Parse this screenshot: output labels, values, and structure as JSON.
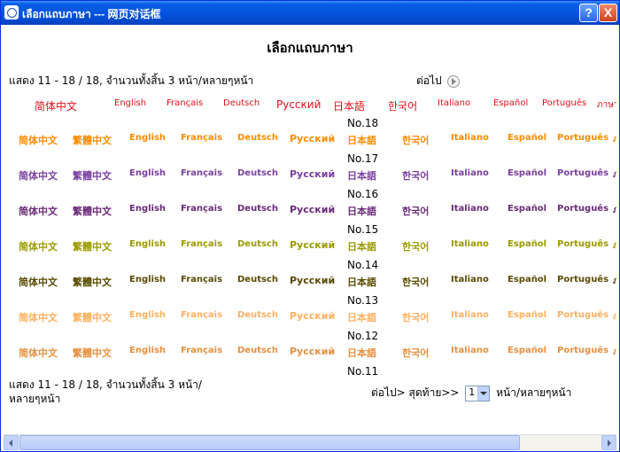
{
  "window": {
    "title": "เลือกแถบภาษา --- 网页对话框",
    "help": "?",
    "close": "X"
  },
  "page_title": "เลือกแถบภาษา",
  "pager_top": {
    "summary": "แสดง 11 - 18 / 18, จำนวนทั้งสิ้น 3 หน้า/หลายๆหน้า",
    "next": "ต่อไป"
  },
  "header_langs": [
    "简体中文",
    "English",
    "Français",
    "Deutsch",
    "Русский",
    "日本語",
    "한국어",
    "Italiano",
    "Español",
    "Português",
    "ภาษาไทย"
  ],
  "row_labels": [
    "简体中文",
    "繁體中文",
    "English",
    "Français",
    "Deutsch",
    "Русский",
    "日本語",
    "한국어",
    "Italiano",
    "Español",
    "Português",
    "ภาษาไทย"
  ],
  "rows": [
    {
      "no": "No.18",
      "color": "#ff8c00"
    },
    {
      "no": "No.17",
      "color": "#7a3fa0"
    },
    {
      "no": "No.16",
      "color": "#6a2a7a"
    },
    {
      "no": "No.15",
      "color": "#9a9a00"
    },
    {
      "no": "No.14",
      "color": "#5a4a00"
    },
    {
      "no": "No.13",
      "color": "#ffb060"
    },
    {
      "no": "No.12",
      "color": "#e89040"
    },
    {
      "no": "No.11",
      "color": ""
    }
  ],
  "pager_bottom": {
    "summary": "แสดง 11 - 18 / 18, จำนวนทั้งสิ้น 3 หน้า/หลายๆหน้า",
    "next": "ต่อไป>",
    "last": "สุดท้าย>>",
    "page_value": "1",
    "page_suffix": "หน้า/หลายๆหน้า"
  }
}
